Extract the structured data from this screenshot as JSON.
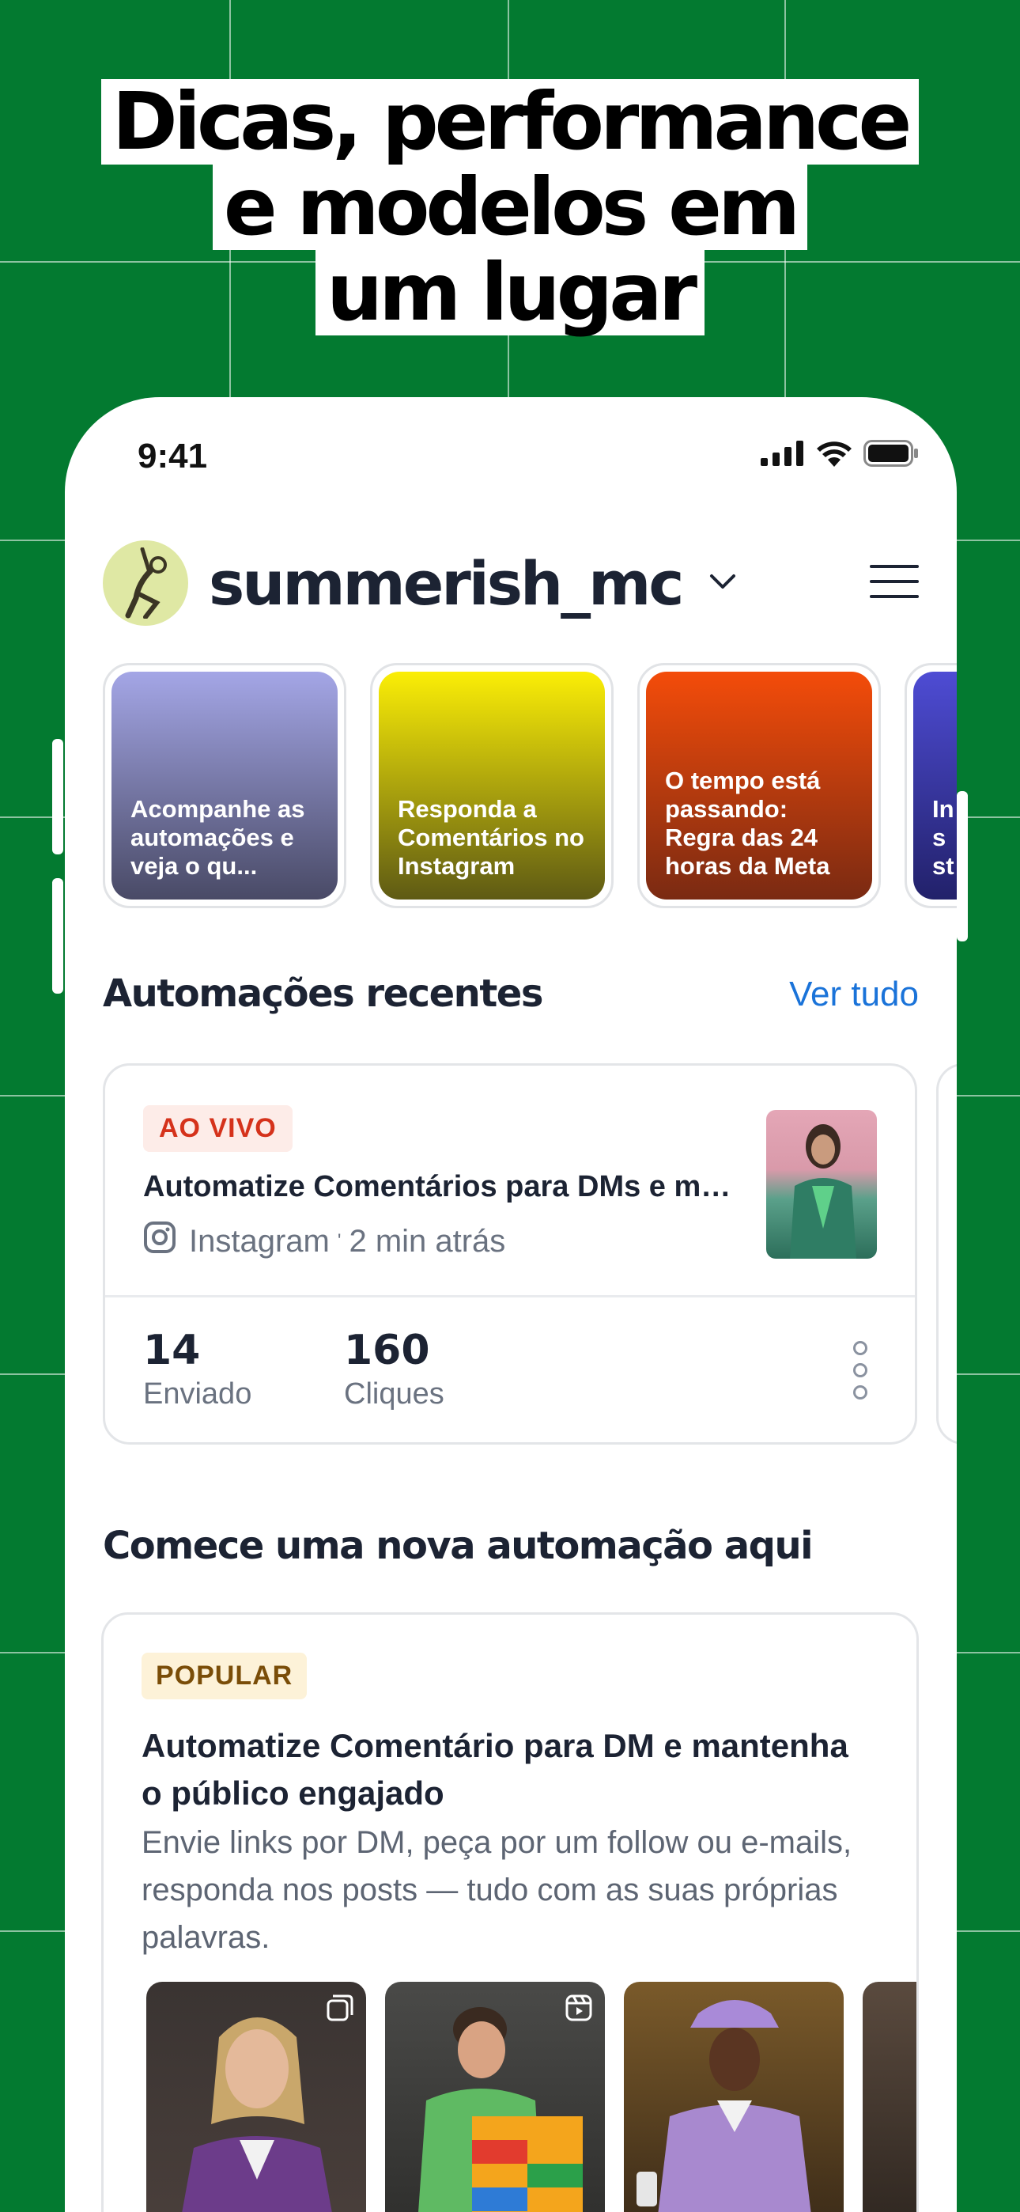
{
  "headline": {
    "line1": "Dicas, performance",
    "line2": "e modelos em",
    "line3": "um lugar"
  },
  "status_bar": {
    "time": "9:41",
    "icons": [
      "cellular-signal-icon",
      "wifi-icon",
      "battery-icon"
    ]
  },
  "header": {
    "username": "summerish_mc",
    "icons": [
      "avatar",
      "chevron-down-icon",
      "hamburger-menu-icon"
    ]
  },
  "stories": [
    {
      "text": "Acompanhe as automações e veja o qu...",
      "gradient": [
        "#a4a6e6",
        "#494a66"
      ]
    },
    {
      "text": "Responda a Comentários no Instagram",
      "gradient": [
        "#fbee06",
        "#5e5a14"
      ]
    },
    {
      "text": "O tempo está passando: Regra das 24 horas da Meta",
      "gradient": [
        "#f44c0a",
        "#7a2a12"
      ]
    },
    {
      "text": "Ins st",
      "gradient": [
        "#4e4cd4",
        "#22216a"
      ]
    }
  ],
  "recent": {
    "title": "Automações recentes",
    "see_all": "Ver tudo",
    "card": {
      "badge": "AO VIVO",
      "title": "Automatize Comentários para DMs e man...",
      "platform": "Instagram",
      "time": "2 min atrás",
      "sent_value": "14",
      "sent_label": "Enviado",
      "clicks_value": "160",
      "clicks_label": "Cliques"
    }
  },
  "new_automation": {
    "title": "Comece uma nova automação aqui",
    "card": {
      "badge": "POPULAR",
      "title": "Automatize Comentário para DM e mantenha o público engajado",
      "description": "Envie links por DM, peça por um follow ou e-mails, responda nos posts — tudo com as suas próprias palavras."
    }
  },
  "colors": {
    "background": "#037a30",
    "accent_link": "#1a73d9",
    "live_badge": "#d5321b",
    "popular_badge": "#7a4d08"
  }
}
